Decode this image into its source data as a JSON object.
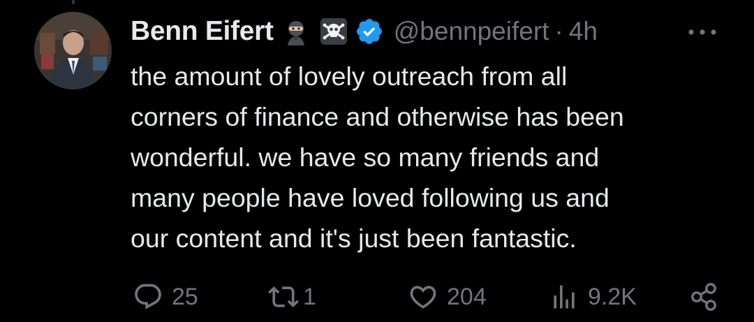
{
  "tweet": {
    "display_name": "Benn Eifert",
    "name_emojis": [
      "ninja-icon",
      "skull-crossbones-icon"
    ],
    "verified": true,
    "handle": "@bennpeifert",
    "separator": "·",
    "time": "4h",
    "more_icon": "more-horizontal-icon",
    "text": "the amount of lovely outreach from all\ncorners of finance and otherwise has been\nwonderful. we have so many friends and\nmany people have loved following us and\nour content and it's just been fantastic."
  },
  "actions": {
    "reply": {
      "icon": "reply-icon",
      "count": "25"
    },
    "retweet": {
      "icon": "retweet-icon",
      "count": "1"
    },
    "like": {
      "icon": "heart-icon",
      "count": "204"
    },
    "views": {
      "icon": "views-chart-icon",
      "count": "9.2K"
    },
    "share": {
      "icon": "share-icon"
    }
  },
  "colors": {
    "background": "#000000",
    "primary_text": "#e7e9ea",
    "secondary_text": "#71767b",
    "verified_blue": "#1d9bf0"
  }
}
